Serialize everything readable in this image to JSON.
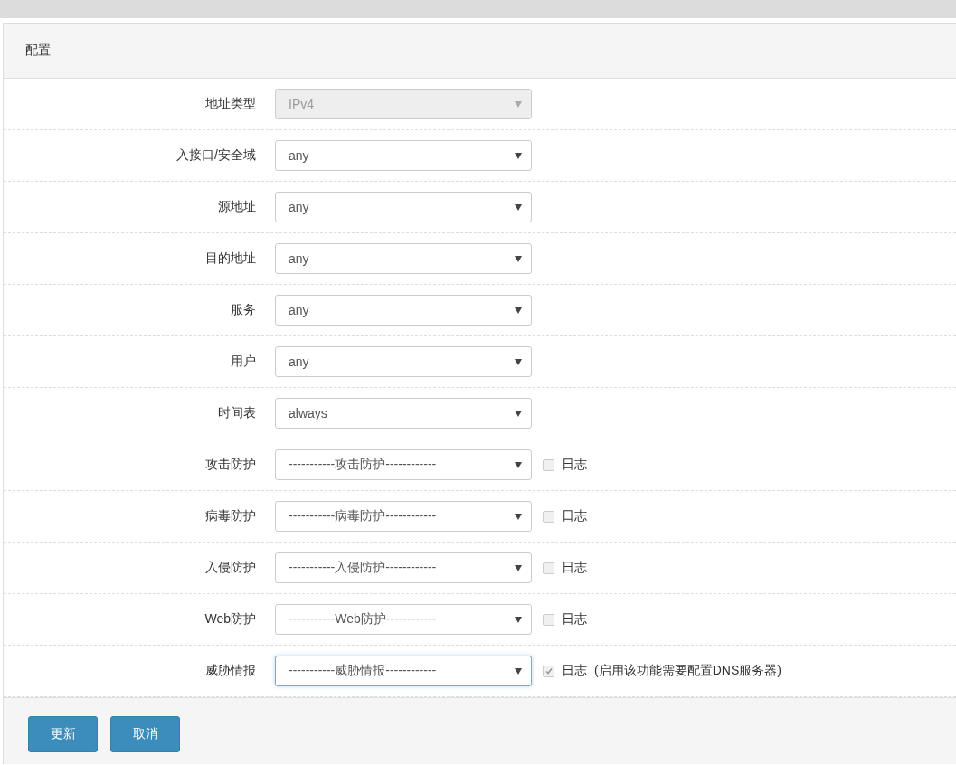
{
  "panel": {
    "title": "配置"
  },
  "fields": [
    {
      "label": "地址类型",
      "value": "IPv4",
      "disabled": true,
      "focused": false
    },
    {
      "label": "入接口/安全域",
      "value": "any",
      "disabled": false,
      "focused": false
    },
    {
      "label": "源地址",
      "value": "any",
      "disabled": false,
      "focused": false
    },
    {
      "label": "目的地址",
      "value": "any",
      "disabled": false,
      "focused": false
    },
    {
      "label": "服务",
      "value": "any",
      "disabled": false,
      "focused": false
    },
    {
      "label": "用户",
      "value": "any",
      "disabled": false,
      "focused": false
    },
    {
      "label": "时间表",
      "value": "always",
      "disabled": false,
      "focused": false
    },
    {
      "label": "攻击防护",
      "value": "-----------攻击防护------------",
      "disabled": false,
      "focused": false,
      "log": {
        "label": "日志",
        "checked": false
      }
    },
    {
      "label": "病毒防护",
      "value": "-----------病毒防护------------",
      "disabled": false,
      "focused": false,
      "log": {
        "label": "日志",
        "checked": false
      }
    },
    {
      "label": "入侵防护",
      "value": "-----------入侵防护------------",
      "disabled": false,
      "focused": false,
      "log": {
        "label": "日志",
        "checked": false
      }
    },
    {
      "label": "Web防护",
      "value": "-----------Web防护------------",
      "disabled": false,
      "focused": false,
      "log": {
        "label": "日志",
        "checked": false
      }
    },
    {
      "label": "威胁情报",
      "value": "-----------威胁情报------------",
      "disabled": false,
      "focused": true,
      "log": {
        "label": "日志",
        "checked": true,
        "note": "(启用该功能需要配置DNS服务器)"
      }
    }
  ],
  "buttons": [
    {
      "label": "更新"
    },
    {
      "label": "取消"
    }
  ]
}
